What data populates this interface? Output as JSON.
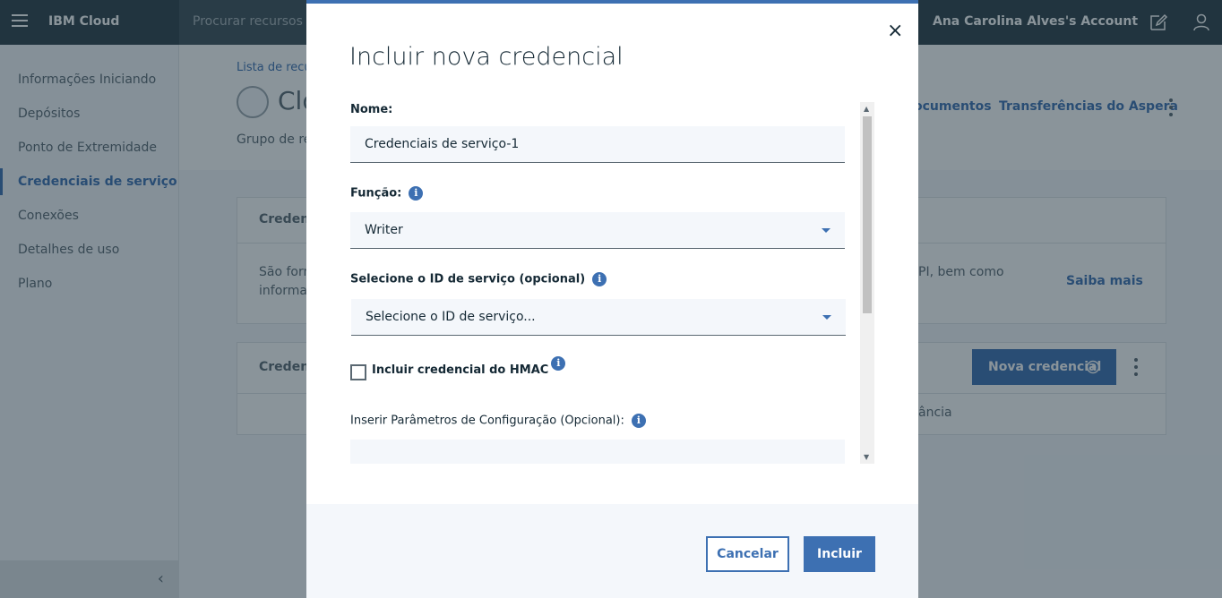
{
  "topbar": {
    "brand": "IBM Cloud",
    "search_placeholder": "Procurar recursos e",
    "account": "Ana Carolina Alves's Account"
  },
  "sidebar": {
    "items": [
      {
        "label": "Informações Iniciando"
      },
      {
        "label": "Depósitos"
      },
      {
        "label": "Ponto de Extremidade"
      },
      {
        "label": "Credenciais de serviço",
        "active": true
      },
      {
        "label": "Conexões"
      },
      {
        "label": "Detalhes de uso"
      },
      {
        "label": "Plano"
      }
    ],
    "collapse_icon": "‹"
  },
  "header": {
    "breadcrumb": "Lista de recu",
    "title": "Clo",
    "subtitle": "Grupo de re",
    "links": [
      "ocumentos",
      "Transferências do Aspera"
    ]
  },
  "cards": {
    "credentials_title": "Credenc",
    "text_line1_left": "São forn",
    "text_line2_left": "informaç",
    "text_line1_right": "PI, bem como",
    "learn_more": "Saiba mais",
    "table_title": "Credenc",
    "new_credential": "Nova credencial",
    "table_cell_right": "ância"
  },
  "modal": {
    "title": "Incluir nova credencial",
    "close_icon": "×",
    "name_label": "Nome:",
    "name_value": "Credenciais de serviço-1",
    "role_label": "Função:",
    "role_value": "Writer",
    "service_id_label": "Selecione o ID de serviço (opcional)",
    "service_id_value": "Selecione o ID de serviço...",
    "hmac_label": "Incluir credencial do HMAC",
    "params_label": "Inserir Parâmetros de Configuração (Opcional):",
    "cancel": "Cancelar",
    "submit": "Incluir"
  },
  "colors": {
    "accent": "#3d70b2",
    "topbar": "#2d3f48"
  }
}
